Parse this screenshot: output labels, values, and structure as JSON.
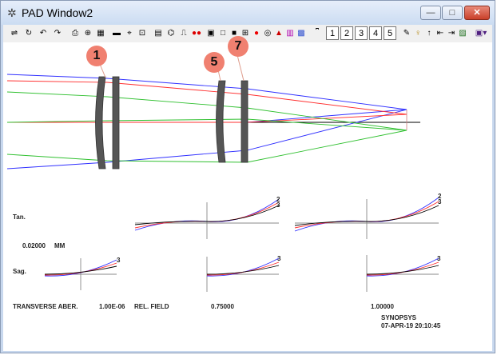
{
  "window": {
    "title": "PAD Window2",
    "icon": "pad-app-icon",
    "min": "—",
    "max": "□",
    "close": "✕"
  },
  "toolbar": {
    "icons": [
      "adjust-icon",
      "rotate-icon",
      "undo-icon",
      "redo-icon",
      "print-icon",
      "zoom-icon",
      "grid-icon",
      "lens-icon",
      "spot-icon",
      "vignette-icon",
      "calc-icon",
      "fan-icon",
      "ruler-icon",
      "tilt-icon",
      "dots-icon",
      "frame-icon",
      "box-icon",
      "fill-icon",
      "select-icon",
      "record-icon",
      "shading-icon",
      "tree-icon",
      "bars-icon",
      "pattern-icon",
      "scale-icon"
    ],
    "surface_buttons": [
      "1",
      "2",
      "3",
      "4",
      "5"
    ],
    "right_icons": [
      "pencil-icon",
      "bulb-icon",
      "up-arrow-icon",
      "left-limit-icon",
      "right-limit-icon",
      "image-icon",
      "menu-icon"
    ]
  },
  "lens_labels": [
    "1",
    "5",
    "7"
  ],
  "plot": {
    "tan_label": "Tan.",
    "sag_label": "Sag.",
    "scale_value": "0.02000",
    "scale_unit": "MM",
    "footer_title": "TRANSVERSE ABER.",
    "footer_scale": "1.00E-06",
    "footer_field": "REL. FIELD",
    "field_0": "0.75000",
    "field_1": "1.00000",
    "software": "SYNOPSYS",
    "timestamp": "07-APR-19 20:10:45",
    "curve_labels": [
      "2",
      "3"
    ]
  }
}
